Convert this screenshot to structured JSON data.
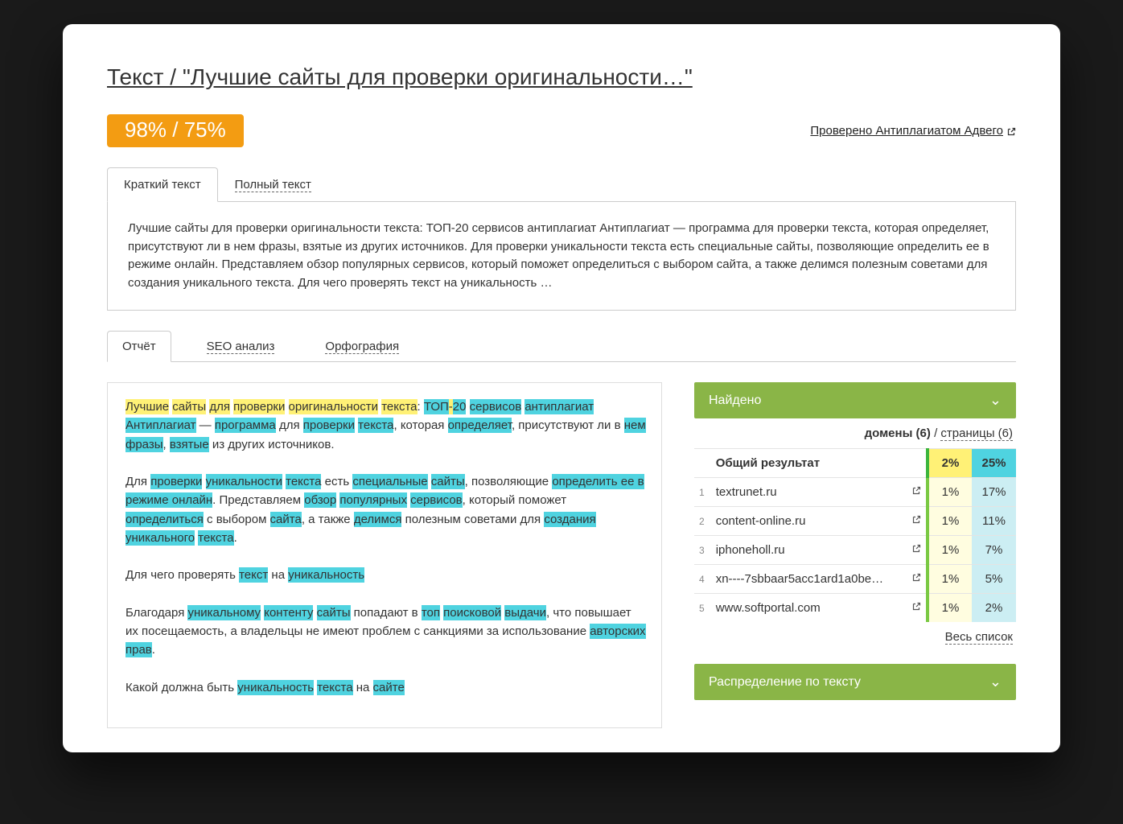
{
  "title": "Текст / \"Лучшие сайты для проверки оригинальности…\"",
  "score": "98% / 75%",
  "checked_by": "Проверено Антиплагиатом Адвего",
  "tabs_top": {
    "short": "Краткий текст",
    "full": "Полный текст"
  },
  "summary": "Лучшие сайты для проверки оригинальности текста: ТОП-20 сервисов антиплагиат Антиплагиат — программа для проверки текста, которая определяет, присутствуют ли в нем фразы, взятые из других источников. Для проверки уникальности текста есть специальные сайты, позволяющие определить ее в режиме онлайн. Представляем обзор популярных сервисов, который поможет определиться с выбором сайта, а также делимся полезным советами для создания уникального текста. Для чего проверять текст на уникальность …",
  "tabs_mid": {
    "report": "Отчёт",
    "seo": "SEO анализ",
    "spell": "Орфография"
  },
  "found": {
    "header": "Найдено",
    "domains_label": "домены (6)",
    "pages_label": "страницы (6)",
    "total_label": "Общий результат",
    "total_p1": "2%",
    "total_p2": "25%",
    "rows": [
      {
        "idx": "1",
        "domain": "textrunet.ru",
        "p1": "1%",
        "p2": "17%"
      },
      {
        "idx": "2",
        "domain": "content-online.ru",
        "p1": "1%",
        "p2": "11%"
      },
      {
        "idx": "3",
        "domain": "iphoneholl.ru",
        "p1": "1%",
        "p2": "7%"
      },
      {
        "idx": "4",
        "domain": "xn----7sbbaar5acc1ard1a0be…",
        "p1": "1%",
        "p2": "5%"
      },
      {
        "idx": "5",
        "domain": "www.softportal.com",
        "p1": "1%",
        "p2": "2%"
      }
    ],
    "all_list": "Весь список"
  },
  "dist_header": "Распределение по тексту",
  "text_segments": {
    "s1_1": "Лучшие",
    "s1_2": "сайты",
    "s1_3": "для",
    "s1_4": "проверки",
    "s1_5": "оригинальности",
    "s1_6": "текста",
    "s1_7": ": ",
    "s1_8": "ТОП",
    "s1_9": "-",
    "s1_10": "20",
    "s1_11": "сервисов",
    "s1_12": "антиплагиат",
    "s2_1": "Антиплагиат",
    "s2_2": " — ",
    "s2_3": "программа",
    "s2_4": " для ",
    "s2_5": "проверки",
    "s2_6": "текста",
    "s2_7": ", которая ",
    "s2_8": "определяет",
    "s2_9": ", присутствуют ли в ",
    "s2_10": "нем",
    "s2_11": "фразы",
    "s2_12": ", ",
    "s2_13": "взятые",
    "s2_14": " из других источников.",
    "s3_1": "Для ",
    "s3_2": "проверки",
    "s3_3": "уникальности",
    "s3_4": "текста",
    "s3_5": " есть ",
    "s3_6": "специальные",
    "s3_7": "сайты",
    "s3_8": ", позволяющие ",
    "s3_9": "определить ее в режиме онлайн",
    "s3_10": ". Представляем ",
    "s3_11": "обзор",
    "s3_12": "популярных",
    "s3_13": "сервисов",
    "s3_14": ", который поможет ",
    "s3_15": "определиться",
    "s3_16": " с выбором ",
    "s3_17": "сайта",
    "s3_18": ", а также ",
    "s3_19": "делимся",
    "s3_20": " полезным советами для ",
    "s3_21": "создания",
    "s3_22": "уникального",
    "s3_23": "текста",
    "s3_24": ".",
    "s4_1": "Для чего проверять ",
    "s4_2": "текст",
    "s4_3": " на ",
    "s4_4": "уникальность",
    "s5_1": "Благодаря ",
    "s5_2": "уникальному",
    "s5_3": "контенту",
    "s5_4": "сайты",
    "s5_5": " попадают в ",
    "s5_6": "топ",
    "s5_7": "поисковой",
    "s5_8": "выдачи",
    "s5_9": ", что повышает их посещаемость, а владельцы не имеют проблем с санкциями за использование ",
    "s5_10": "авторских",
    "s5_11": "прав",
    "s5_12": ".",
    "s6_1": "Какой должна быть ",
    "s6_2": "уникальность",
    "s6_3": "текста",
    "s6_4": " на ",
    "s6_5": "сайте"
  }
}
